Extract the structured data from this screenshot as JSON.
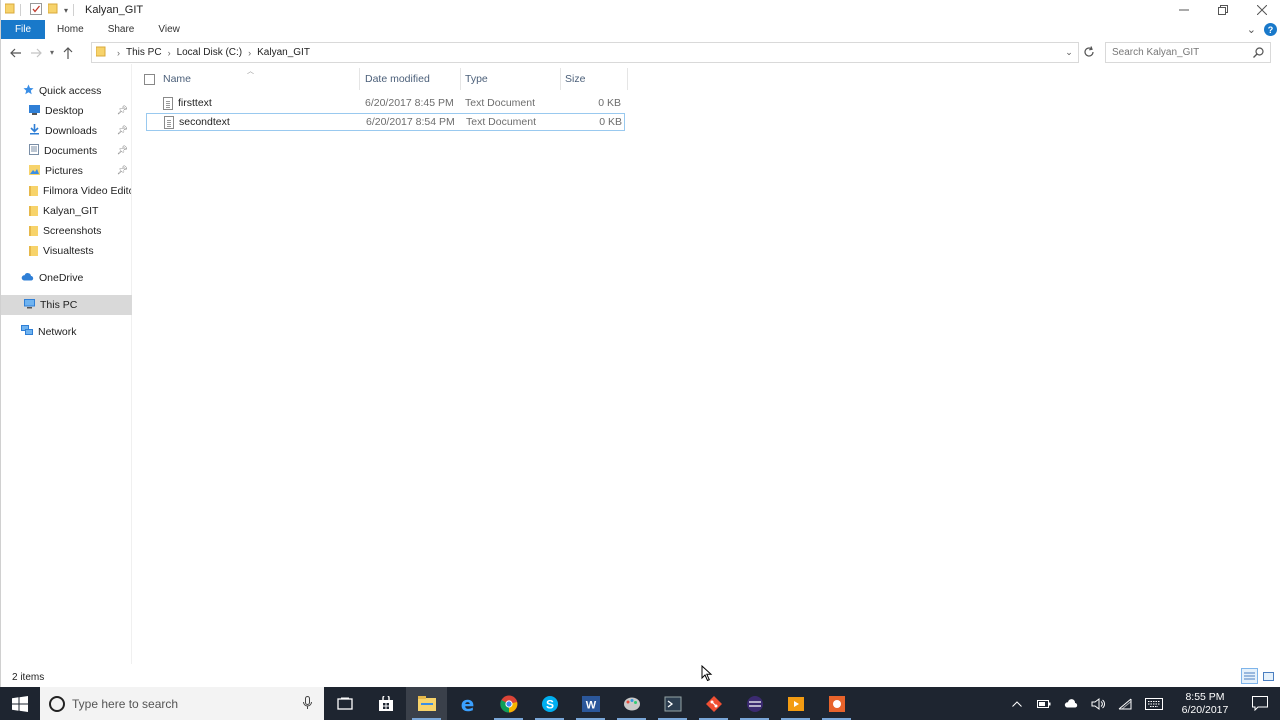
{
  "window": {
    "title": "Kalyan_GIT",
    "controls": {
      "minimize": "—",
      "restore": "❐",
      "close": "✕"
    }
  },
  "ribbon": {
    "tabs": [
      "File",
      "Home",
      "Share",
      "View"
    ],
    "expand": "⌄",
    "help": "?"
  },
  "address": {
    "crumbs": [
      "This PC",
      "Local Disk (C:)",
      "Kalyan_GIT"
    ]
  },
  "search": {
    "placeholder": "Search Kalyan_GIT"
  },
  "nav": {
    "quick_access": "Quick access",
    "pinned": [
      "Desktop",
      "Downloads",
      "Documents",
      "Pictures"
    ],
    "folders": [
      "Filmora Video Edito",
      "Kalyan_GIT",
      "Screenshots",
      "Visualtests"
    ],
    "onedrive": "OneDrive",
    "this_pc": "This PC",
    "network": "Network"
  },
  "columns": {
    "name": "Name",
    "date": "Date modified",
    "type": "Type",
    "size": "Size"
  },
  "files": [
    {
      "name": "firsttext",
      "date": "6/20/2017 8:45 PM",
      "type": "Text Document",
      "size": "0 KB"
    },
    {
      "name": "secondtext",
      "date": "6/20/2017 8:54 PM",
      "type": "Text Document",
      "size": "0 KB"
    }
  ],
  "status": {
    "items": "2 items"
  },
  "taskbar": {
    "search_placeholder": "Type here to search",
    "time": "8:55 PM",
    "date": "6/20/2017"
  },
  "colors": {
    "accent": "#1979ca",
    "taskbar": "#1e2530",
    "selected": "#d9d9d9"
  }
}
